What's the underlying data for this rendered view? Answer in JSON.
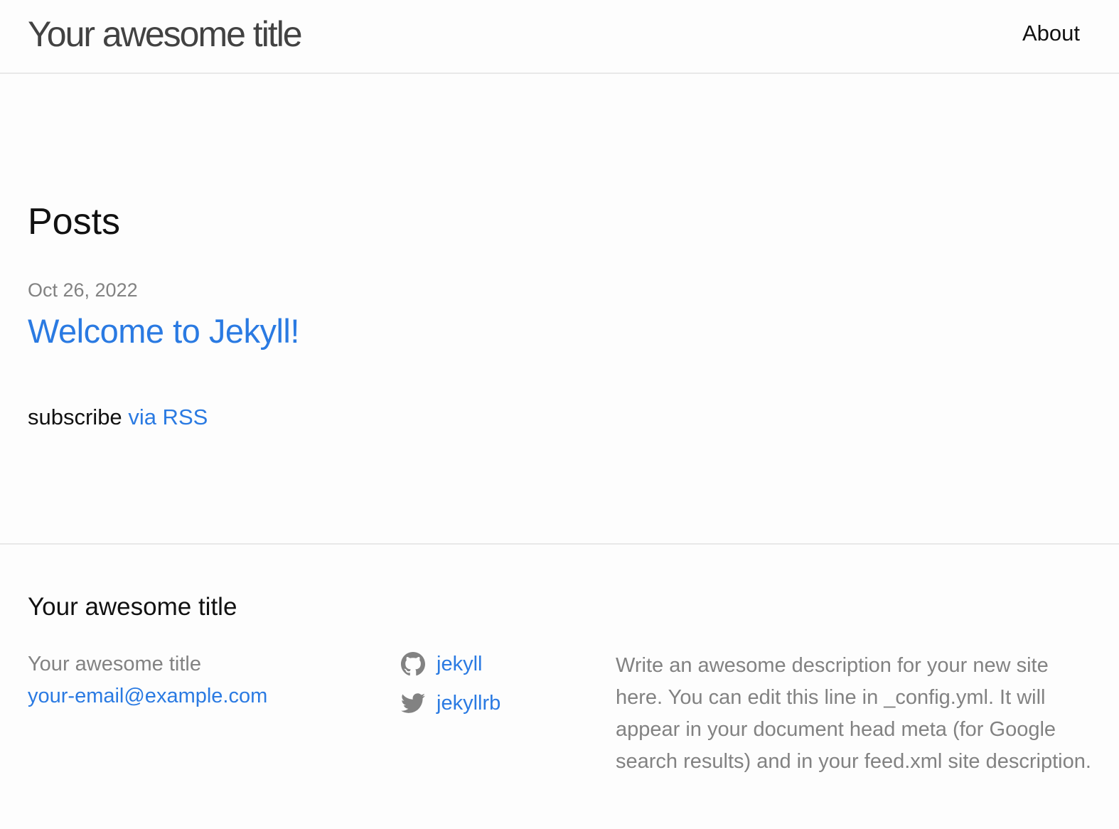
{
  "header": {
    "site_title": "Your awesome title",
    "nav": {
      "about_label": "About"
    }
  },
  "main": {
    "heading": "Posts",
    "posts": [
      {
        "date": "Oct 26, 2022",
        "title": "Welcome to Jekyll!"
      }
    ],
    "rss": {
      "prefix": "subscribe",
      "link_label": "via RSS"
    }
  },
  "footer": {
    "heading": "Your awesome title",
    "contact": {
      "name": "Your awesome title",
      "email": "your-email@example.com"
    },
    "social": [
      {
        "icon": "github-icon",
        "label": "jekyll"
      },
      {
        "icon": "twitter-icon",
        "label": "jekyllrb"
      }
    ],
    "description": "Write an awesome description for your new site here. You can edit this line in _config.yml. It will appear in your document head meta (for Google search results) and in your feed.xml site description."
  },
  "colors": {
    "link": "#2a7ae2",
    "muted": "#828282",
    "text": "#111111",
    "title": "#424242",
    "border": "#e8e8e8",
    "background": "#fdfdfd"
  }
}
